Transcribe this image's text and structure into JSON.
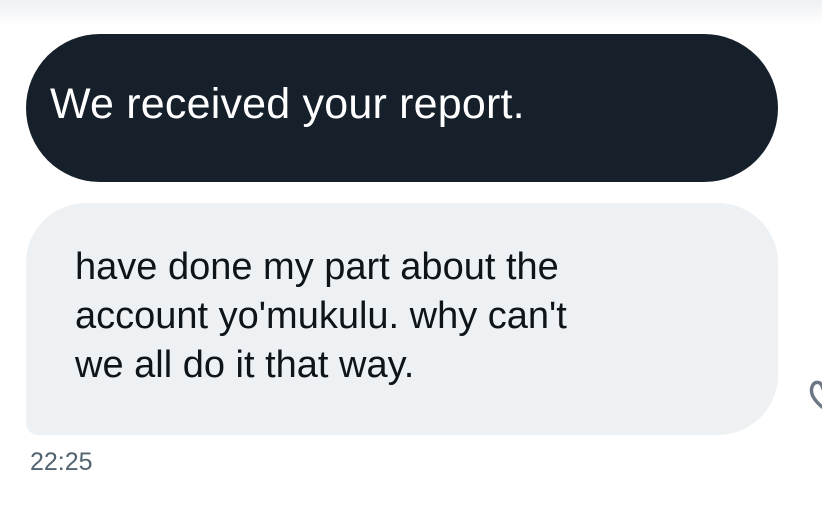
{
  "conversation": {
    "messages": [
      {
        "text": "We received your report.",
        "style": "dark"
      },
      {
        "text": "have done my part about the\naccount yo'mukulu. why can't\nwe all do it that way.",
        "style": "light"
      }
    ],
    "timestamp": "22:25"
  },
  "icons": {
    "reaction": "heart-outline-icon"
  },
  "colors": {
    "dark_bubble": "#16202a",
    "light_bubble": "#eef1f3",
    "timestamp_text": "#536471"
  }
}
